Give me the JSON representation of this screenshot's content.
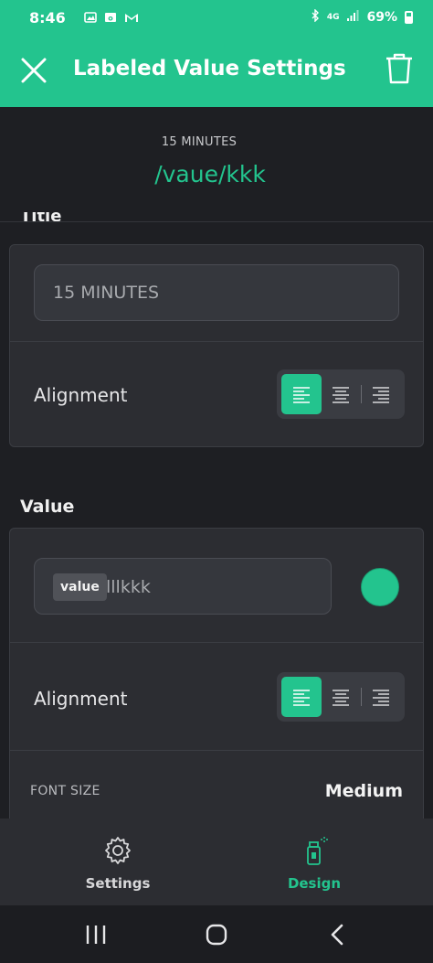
{
  "status_bar": {
    "time": "8:46",
    "network": "4G",
    "battery": "69%",
    "icons": [
      "image-icon",
      "outlook-icon",
      "gmail-icon",
      "bluetooth-icon",
      "signal-icon",
      "battery-icon"
    ]
  },
  "header": {
    "title": "Labeled Value Settings",
    "close_icon": "close-icon",
    "delete_icon": "trash-icon"
  },
  "preview": {
    "label": "15 MINUTES",
    "value": "/vaue/kkk"
  },
  "title_section": {
    "heading": "Title",
    "input_value": "15 MINUTES",
    "alignment_label": "Alignment",
    "alignment_options": [
      "left",
      "center",
      "right"
    ],
    "alignment_selected": "left"
  },
  "value_section": {
    "heading": "Value",
    "chip_label": "value",
    "input_suffix": "lllkkk",
    "color": "#23c48e",
    "alignment_label": "Alignment",
    "alignment_options": [
      "left",
      "center",
      "right"
    ],
    "alignment_selected": "left",
    "font_size_label": "FONT SIZE",
    "font_size_value": "Medium"
  },
  "bottom_nav": {
    "items": [
      {
        "label": "Settings",
        "icon": "gear-icon",
        "active": false
      },
      {
        "label": "Design",
        "icon": "spray-can-icon",
        "active": true
      }
    ]
  },
  "colors": {
    "accent": "#23c48e",
    "background": "#1e1f23",
    "card": "#2c2d32",
    "inactive_nav": "#d8d8da"
  },
  "system_nav": [
    "recent-apps-icon",
    "home-icon",
    "back-icon"
  ]
}
